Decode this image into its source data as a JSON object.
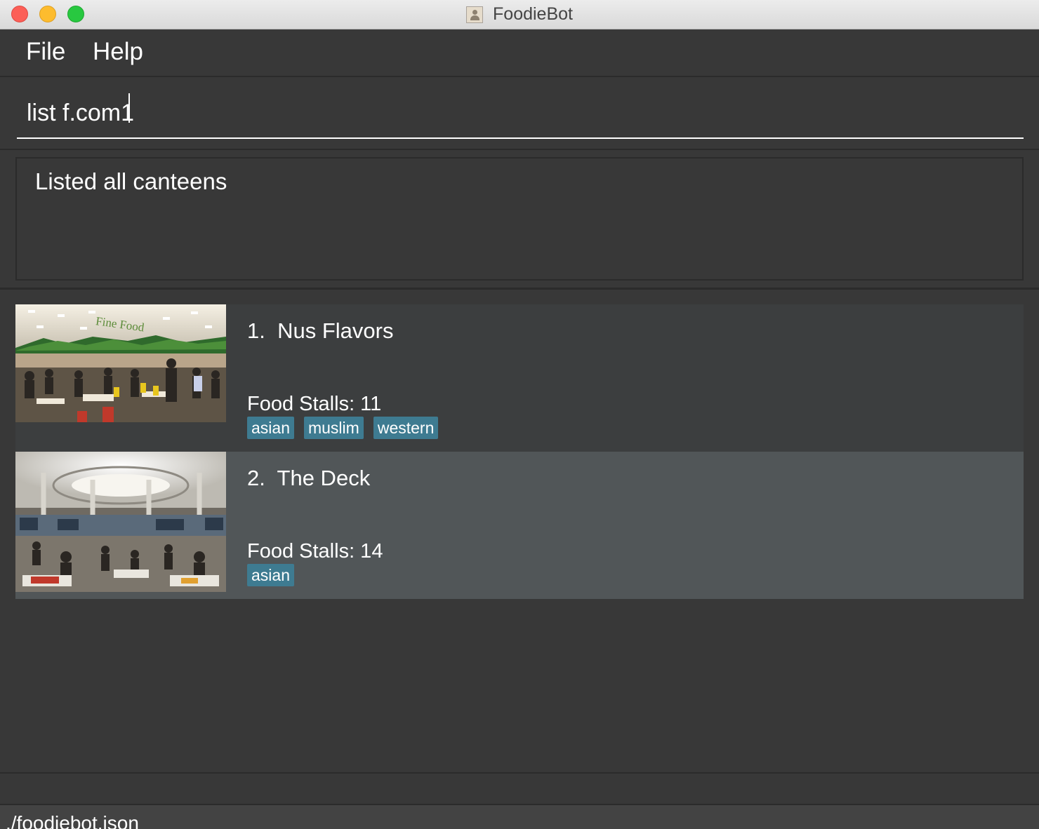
{
  "window": {
    "title": "FoodieBot"
  },
  "menu": {
    "file": "File",
    "help": "Help"
  },
  "command": {
    "value": "list f.com1"
  },
  "result": {
    "message": "Listed all canteens"
  },
  "canteens": [
    {
      "index": "1.",
      "name": "Nus Flavors",
      "stalls": "Food Stalls: 11",
      "tags": [
        "asian",
        "muslim",
        "western"
      ],
      "photo": "Fine Food"
    },
    {
      "index": "2.",
      "name": "The Deck",
      "stalls": "Food Stalls: 14",
      "tags": [
        "asian"
      ]
    }
  ],
  "status": {
    "path": "./foodiebot.json"
  },
  "colors": {
    "background": "#383838",
    "tag": "#3e7b91",
    "selected_card": "#515658"
  }
}
